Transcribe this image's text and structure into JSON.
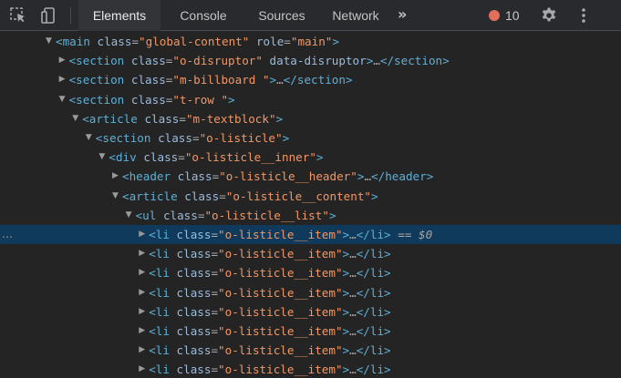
{
  "toolbar": {
    "tabs": [
      {
        "label": "Elements",
        "active": true
      },
      {
        "label": "Console",
        "active": false
      },
      {
        "label": "Sources",
        "active": false
      },
      {
        "label": "Network",
        "active": false
      }
    ],
    "more_tabs": "»",
    "issues_count": "10",
    "issues_color": "#e46e5c",
    "icons": {
      "inspect": "select-element-icon",
      "device": "device-toolbar-icon",
      "settings": "gear-icon",
      "menu": "kebab-menu-icon"
    }
  },
  "tree": {
    "selected_marker": "== $0",
    "row_menu": "…",
    "rows": [
      {
        "depth": 0,
        "arrow": "▼",
        "tag": "main",
        "attrs": [
          {
            "name": "class",
            "value": "\"global-content\""
          },
          {
            "name": "role",
            "value": "\"main\""
          }
        ],
        "tail": ">"
      },
      {
        "depth": 1,
        "arrow": "▶",
        "tag": "section",
        "attrs": [
          {
            "name": "class",
            "value": "\"o-disruptor\""
          },
          {
            "name": "data-disruptor",
            "value": ""
          }
        ],
        "tail": ">…</section>"
      },
      {
        "depth": 1,
        "arrow": "▶",
        "tag": "section",
        "attrs": [
          {
            "name": "class",
            "value": "\"m-billboard \""
          }
        ],
        "tail": ">…</section>"
      },
      {
        "depth": 1,
        "arrow": "▼",
        "tag": "section",
        "attrs": [
          {
            "name": "class",
            "value": "\"t-row \""
          }
        ],
        "tail": ">"
      },
      {
        "depth": 2,
        "arrow": "▼",
        "tag": "article",
        "attrs": [
          {
            "name": "class",
            "value": "\"m-textblock\""
          }
        ],
        "tail": ">"
      },
      {
        "depth": 3,
        "arrow": "▼",
        "tag": "section",
        "attrs": [
          {
            "name": "class",
            "value": "\"o-listicle\""
          }
        ],
        "tail": ">"
      },
      {
        "depth": 4,
        "arrow": "▼",
        "tag": "div",
        "attrs": [
          {
            "name": "class",
            "value": "\"o-listicle__inner\""
          }
        ],
        "tail": ">"
      },
      {
        "depth": 5,
        "arrow": "▶",
        "tag": "header",
        "attrs": [
          {
            "name": "class",
            "value": "\"o-listicle__header\""
          }
        ],
        "tail": ">…</header>"
      },
      {
        "depth": 5,
        "arrow": "▼",
        "tag": "article",
        "attrs": [
          {
            "name": "class",
            "value": "\"o-listicle__content\""
          }
        ],
        "tail": ">"
      },
      {
        "depth": 6,
        "arrow": "▼",
        "tag": "ul",
        "attrs": [
          {
            "name": "class",
            "value": "\"o-listicle__list\""
          }
        ],
        "tail": ">"
      },
      {
        "depth": 7,
        "arrow": "▶",
        "tag": "li",
        "attrs": [
          {
            "name": "class",
            "value": "\"o-listicle__item\""
          }
        ],
        "tail": ">…</li>",
        "selected": true
      },
      {
        "depth": 7,
        "arrow": "▶",
        "tag": "li",
        "attrs": [
          {
            "name": "class",
            "value": "\"o-listicle__item\""
          }
        ],
        "tail": ">…</li>"
      },
      {
        "depth": 7,
        "arrow": "▶",
        "tag": "li",
        "attrs": [
          {
            "name": "class",
            "value": "\"o-listicle__item\""
          }
        ],
        "tail": ">…</li>"
      },
      {
        "depth": 7,
        "arrow": "▶",
        "tag": "li",
        "attrs": [
          {
            "name": "class",
            "value": "\"o-listicle__item\""
          }
        ],
        "tail": ">…</li>"
      },
      {
        "depth": 7,
        "arrow": "▶",
        "tag": "li",
        "attrs": [
          {
            "name": "class",
            "value": "\"o-listicle__item\""
          }
        ],
        "tail": ">…</li>"
      },
      {
        "depth": 7,
        "arrow": "▶",
        "tag": "li",
        "attrs": [
          {
            "name": "class",
            "value": "\"o-listicle__item\""
          }
        ],
        "tail": ">…</li>"
      },
      {
        "depth": 7,
        "arrow": "▶",
        "tag": "li",
        "attrs": [
          {
            "name": "class",
            "value": "\"o-listicle__item\""
          }
        ],
        "tail": ">…</li>"
      },
      {
        "depth": 7,
        "arrow": "▶",
        "tag": "li",
        "attrs": [
          {
            "name": "class",
            "value": "\"o-listicle__item\""
          }
        ],
        "tail": ">…</li>"
      }
    ]
  }
}
